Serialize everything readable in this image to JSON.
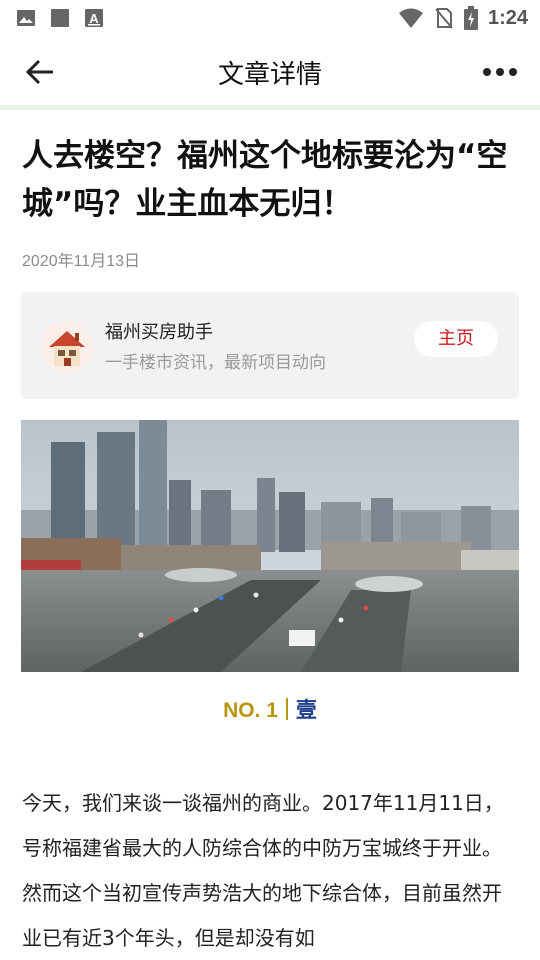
{
  "status_bar": {
    "time": "1:24",
    "left_icons": [
      "image-icon",
      "square-icon",
      "a-letter-icon"
    ],
    "right_icons": [
      "wifi-icon",
      "no-sim-icon",
      "battery-icon"
    ]
  },
  "nav": {
    "title": "文章详情",
    "back_icon": "arrow-left-icon",
    "more_icon": "more-dots-icon"
  },
  "article": {
    "title": "人去楼空？福州这个地标要沦为“空城”吗？业主血本无归！",
    "date": "2020年11月13日",
    "author": {
      "name": "福州买房助手",
      "description": "一手楼市资讯，最新项目动向",
      "home_button": "主页",
      "home_color": "#d0191f"
    },
    "section": {
      "number": "NO. 1",
      "chinese": "壹",
      "number_color": "#b8960a",
      "chinese_color": "#1e3d8f"
    },
    "body": "今天，我们来谈一谈福州的商业。2017年11月11日，号称福建省最大的人防综合体的中防万宝城终于开业。然而这个当初宣传声势浩大的地下综合体，目前虽然开业已有近3个年头，但是却没有如"
  },
  "colors": {
    "divider": "#e6f3e6",
    "card_bg": "#f2f2f2"
  }
}
